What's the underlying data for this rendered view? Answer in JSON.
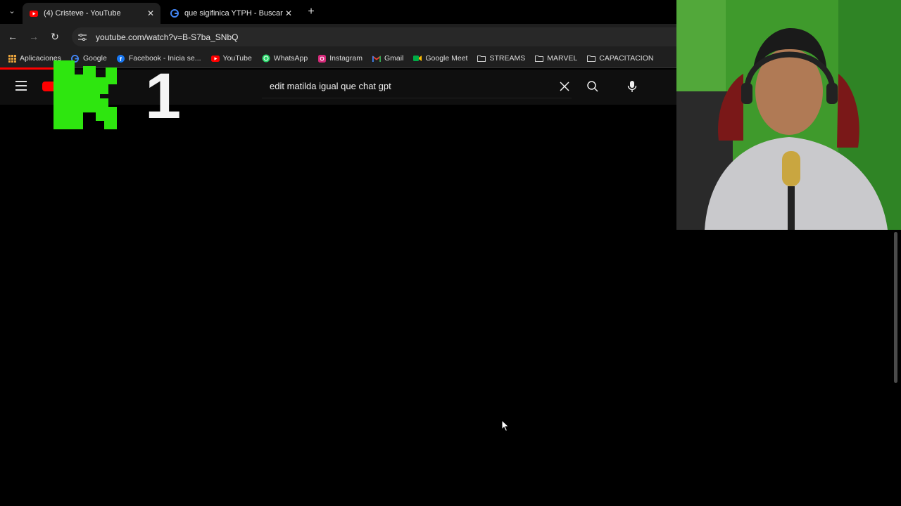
{
  "browser": {
    "tabs": [
      {
        "title": "(4) Cristeve - YouTube",
        "favicon": "youtube-icon",
        "active": true
      },
      {
        "title": "que sigifinica YTPH - Buscar co",
        "favicon": "google-icon",
        "active": false
      }
    ],
    "url": "youtube.com/watch?v=B-S7ba_SNbQ",
    "bookmarks": [
      {
        "label": "Aplicaciones",
        "icon": "apps-grid-icon"
      },
      {
        "label": "Google",
        "icon": "google-icon"
      },
      {
        "label": "Facebook - Inicia se...",
        "icon": "facebook-icon"
      },
      {
        "label": "YouTube",
        "icon": "youtube-icon"
      },
      {
        "label": "WhatsApp",
        "icon": "whatsapp-icon"
      },
      {
        "label": "Instagram",
        "icon": "instagram-icon"
      },
      {
        "label": "Gmail",
        "icon": "gmail-icon"
      },
      {
        "label": "Google Meet",
        "icon": "google-meet-icon"
      },
      {
        "label": "STREAMS",
        "icon": "folder-icon"
      },
      {
        "label": "MARVEL",
        "icon": "folder-icon"
      },
      {
        "label": "CAPACITACION",
        "icon": "folder-icon"
      }
    ]
  },
  "youtube": {
    "search_query": "edit matilda  igual que chat gpt"
  },
  "overlay": {
    "number": "1"
  },
  "colors": {
    "accent_red": "#ff0000",
    "green_k": "#2ee60f",
    "background": "#000000"
  }
}
